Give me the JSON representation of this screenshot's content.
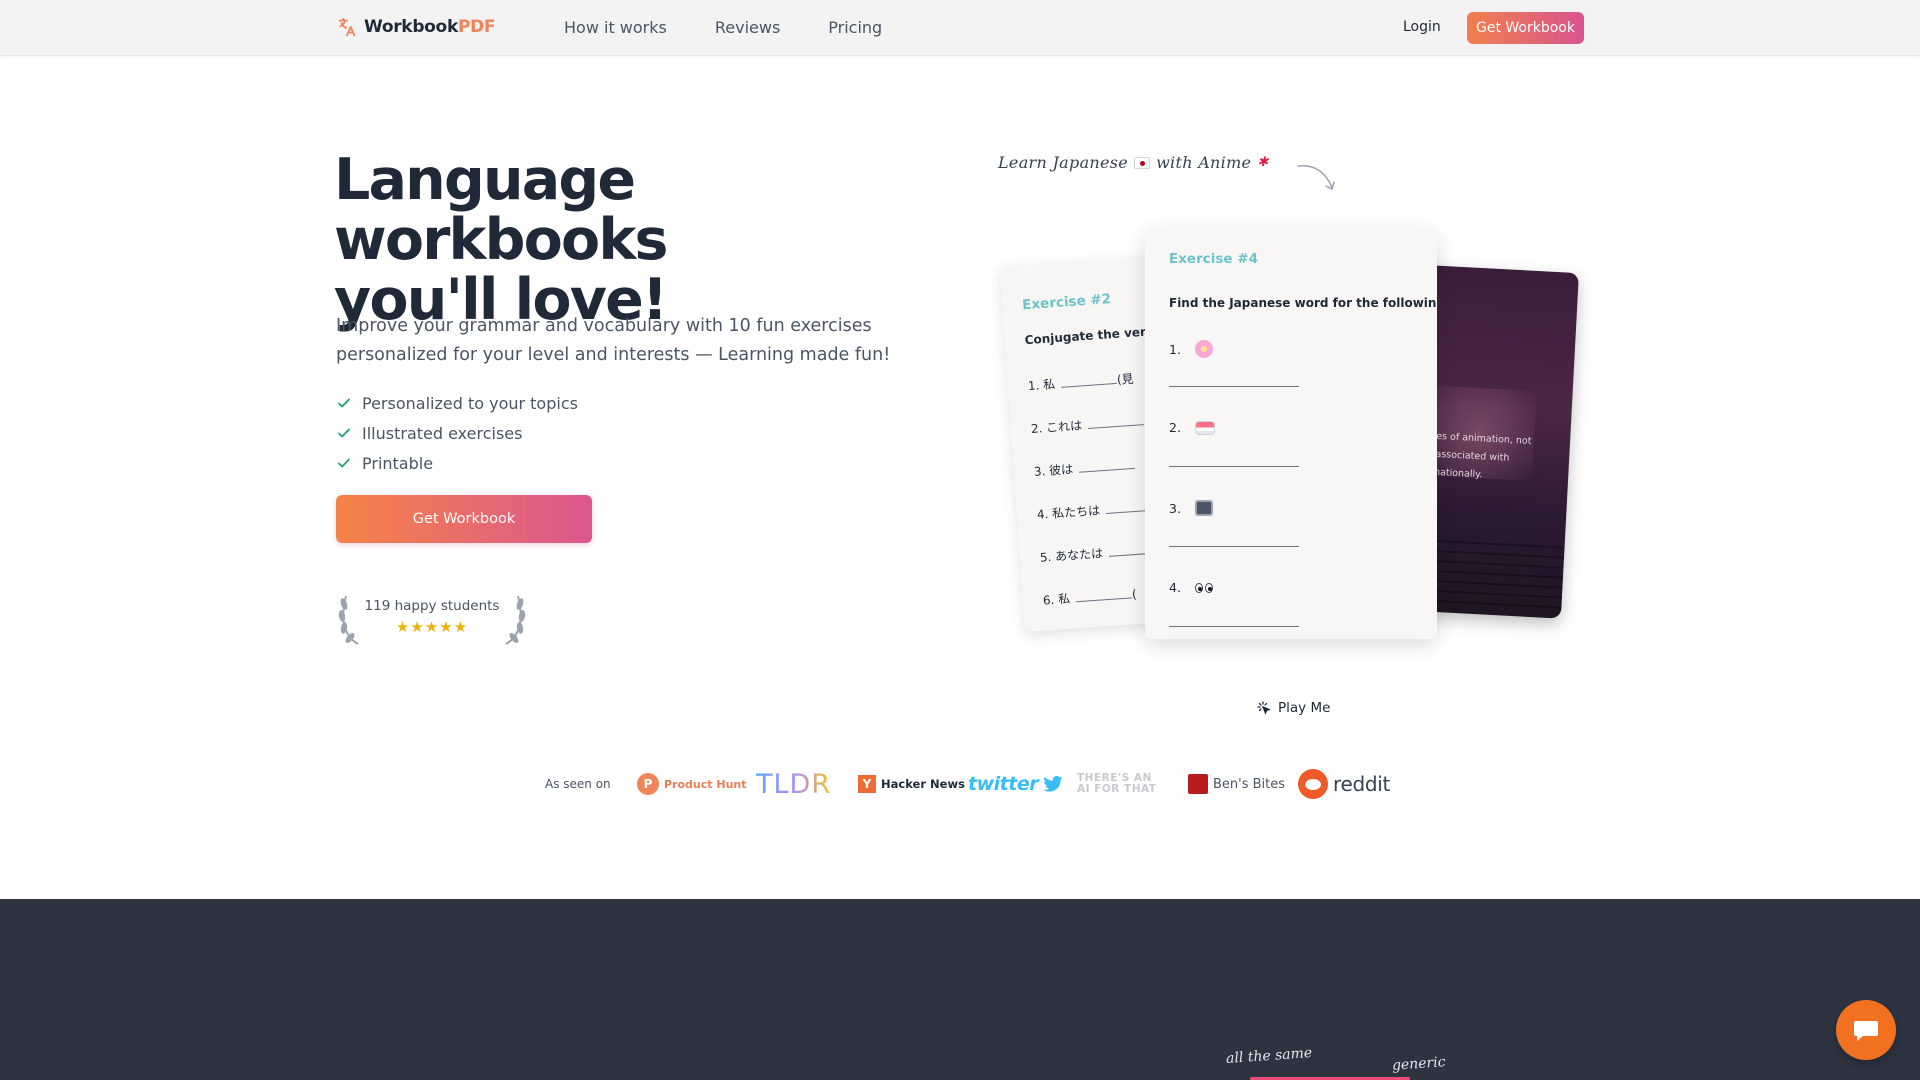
{
  "nav": {
    "logo_main": "Workbook",
    "logo_accent": "PDF",
    "links": [
      "How it works",
      "Reviews",
      "Pricing"
    ],
    "login": "Login",
    "cta": "Get Workbook"
  },
  "hero": {
    "title_line1": "Language workbooks",
    "title_line2": "you'll love!",
    "subtitle": "Improve your grammar and vocabulary with 10 fun exercises personalized for your level and interests — Learning made fun!",
    "features": [
      "Personalized to your topics",
      "Illustrated exercises",
      "Printable"
    ],
    "cta": "Get Workbook",
    "rating_text": "119 happy students",
    "stars": "★★★★★"
  },
  "preview": {
    "tagline_part1": "Learn Japanese",
    "tagline_part2": "with Anime",
    "card_left": {
      "label": "Exercise #2",
      "instruction": "Conjugate the verb i",
      "items": [
        "1.  私",
        "2.  これは",
        "3.  彼は",
        "4.  私たちは",
        "5.  あなたは",
        "6.  私"
      ],
      "item_suffixes": [
        "(見",
        "",
        "",
        "",
        "",
        "("
      ]
    },
    "card_front": {
      "label": "Exercise #4",
      "instruction": "Find the Japanese word for the following emojis",
      "numbers": [
        "1.",
        "2.",
        "3.",
        "4."
      ],
      "emoji_names": [
        "cherry-blossom",
        "sushi",
        "television",
        "eyes"
      ]
    },
    "card_back_text": "to all types of animation, not\nart style associated with\nons internationally.",
    "play_label": "Play Me"
  },
  "seen_on": {
    "label": "As seen on",
    "product_hunt": "Product Hunt",
    "tldr": "TLDR",
    "hacker_news": "Hacker News",
    "twitter": "twitter",
    "aift_line1": "THERE'S AN",
    "aift_line2": "AI FOR THAT",
    "bens_bites": "Ben's Bites",
    "reddit": "reddit"
  },
  "dark_section": {
    "note1": "all the same",
    "note2": "generic"
  },
  "colors": {
    "accent_orange": "#f37f4e",
    "accent_pink": "#d9548f",
    "exercise_teal": "#6cc3c9",
    "dark_bg": "#2d3341"
  }
}
